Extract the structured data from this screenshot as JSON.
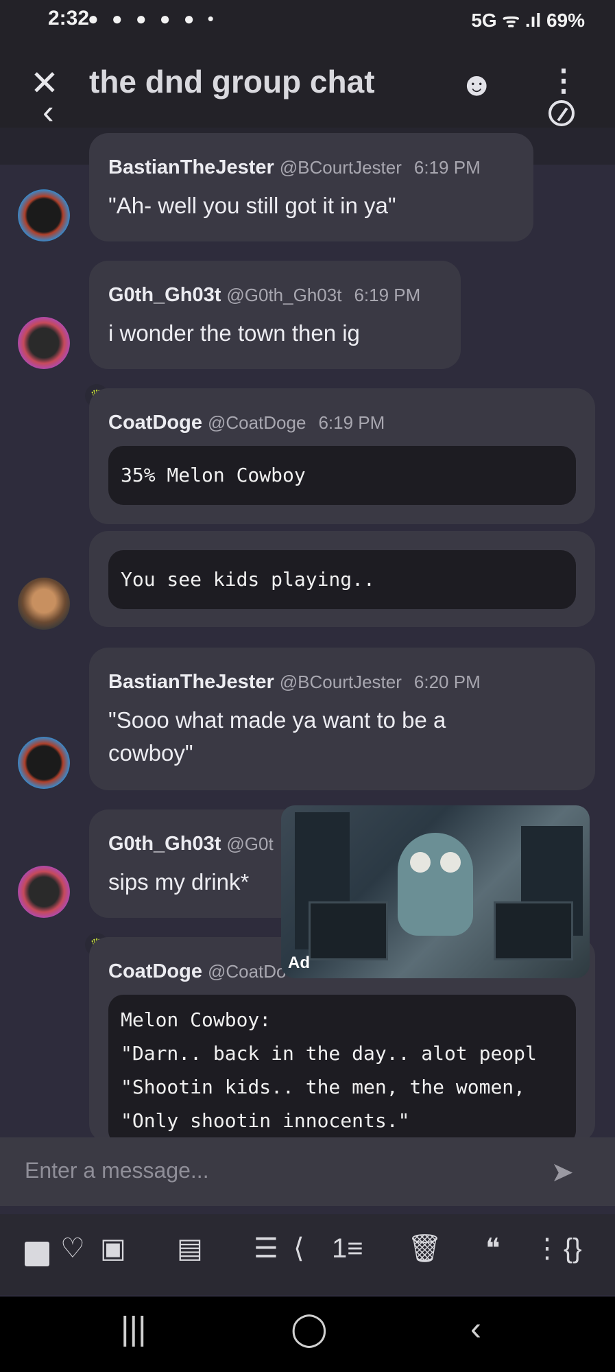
{
  "status_bar": {
    "time": "2:32",
    "notifications": "● ● ● ● ● •",
    "right": "5G ᯤ .ıl 69%"
  },
  "header": {
    "title": "the dnd group chat"
  },
  "messages": [
    {
      "name": "BastianTheJester",
      "handle": "@BCourtJester",
      "time": "6:19 PM",
      "text": "\"Ah- well you still got it in ya\""
    },
    {
      "name": "G0th_Gh03t",
      "handle": "@G0th_Gh03t",
      "time": "6:19 PM",
      "text": "i wonder the town then ig"
    },
    {
      "name": "CoatDoge",
      "handle": "@CoatDoge",
      "time": "6:19 PM",
      "code": "35% Melon Cowboy"
    },
    {
      "code": "You see kids playing.."
    },
    {
      "name": "BastianTheJester",
      "handle": "@BCourtJester",
      "time": "6:20 PM",
      "text_line1": "\"Sooo what made ya want to be a",
      "text_line2": "cowboy\""
    },
    {
      "name": "G0th_Gh03t",
      "handle": "@G0t",
      "text": "sips my drink*"
    },
    {
      "name": "CoatDoge",
      "handle": "@CoatDo",
      "code": "Melon Cowboy:\n\"Darn.. back in the day.. alot peopl\n\"Shootin kids.. the men, the women,\n\"Only shootin innocents.\""
    }
  ],
  "ad": {
    "label": "Ad"
  },
  "input": {
    "placeholder": "Enter a message..."
  },
  "icons": {
    "close": "✕",
    "back": "‹",
    "add_member": "☻",
    "menu": "⋮",
    "send": "➤",
    "heart": "♡",
    "share": "⟨",
    "list": "☰",
    "numbered": "1≡",
    "trash": "🗑",
    "quote": "❝",
    "more": "⋮",
    "braces": "{}",
    "nav_recent": "|||",
    "nav_home": "◯",
    "nav_back": "‹"
  }
}
